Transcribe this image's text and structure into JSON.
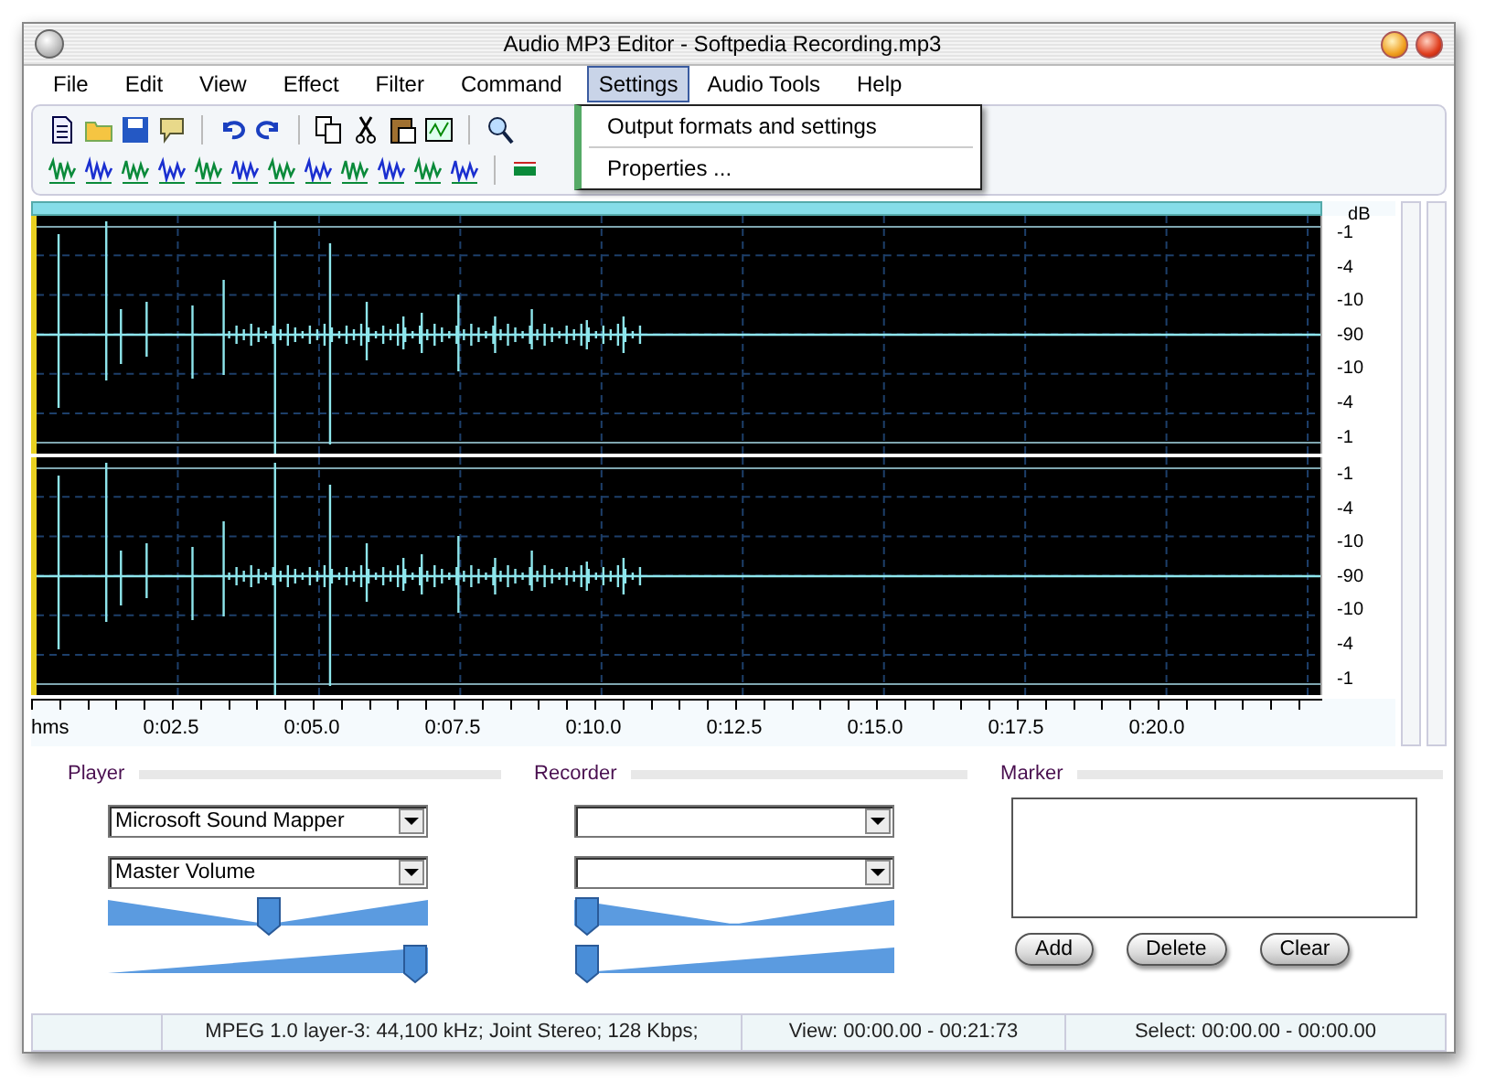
{
  "window": {
    "title": "Audio MP3 Editor - Softpedia Recording.mp3"
  },
  "menu": [
    {
      "label": "File",
      "selected": false
    },
    {
      "label": "Edit",
      "selected": false
    },
    {
      "label": "View",
      "selected": false
    },
    {
      "label": "Effect",
      "selected": false
    },
    {
      "label": "Filter",
      "selected": false
    },
    {
      "label": "Command",
      "selected": false
    },
    {
      "label": "Settings",
      "selected": true
    },
    {
      "label": "Audio Tools",
      "selected": false
    },
    {
      "label": "Help",
      "selected": false
    }
  ],
  "dropdown": {
    "items": [
      "Output formats and settings",
      "Properties ..."
    ]
  },
  "waveform": {
    "db_unit": "dB",
    "channels": [
      {
        "labels": [
          "-1",
          "-4",
          "-10",
          "-90",
          "-10",
          "-4",
          "-1"
        ]
      },
      {
        "labels": [
          "-1",
          "-4",
          "-10",
          "-90",
          "-10",
          "-4",
          "-1"
        ]
      }
    ],
    "time_unit": "hms",
    "time_labels": [
      "0:02.5",
      "0:05.0",
      "0:07.5",
      "0:10.0",
      "0:12.5",
      "0:15.0",
      "0:17.5",
      "0:20.0"
    ]
  },
  "player": {
    "title": "Player",
    "device": "Microsoft Sound Mapper",
    "source": "Master Volume",
    "sliders": [
      {
        "kind": "balance",
        "level": 0.5
      },
      {
        "kind": "volume",
        "level": 1.0
      }
    ]
  },
  "recorder": {
    "title": "Recorder",
    "sliders": [
      {
        "kind": "balance",
        "level": 0.0
      },
      {
        "kind": "volume",
        "level": 0.0
      }
    ]
  },
  "marker": {
    "title": "Marker",
    "buttons": [
      "Add",
      "Delete",
      "Clear"
    ]
  },
  "status_bar": [
    "MPEG 1.0 layer-3: 44,100 kHz; Joint Stereo; 128 Kbps;",
    "View: 00:00.00 - 00:21:73",
    "Select: 00:00.00 - 00:00.00"
  ]
}
